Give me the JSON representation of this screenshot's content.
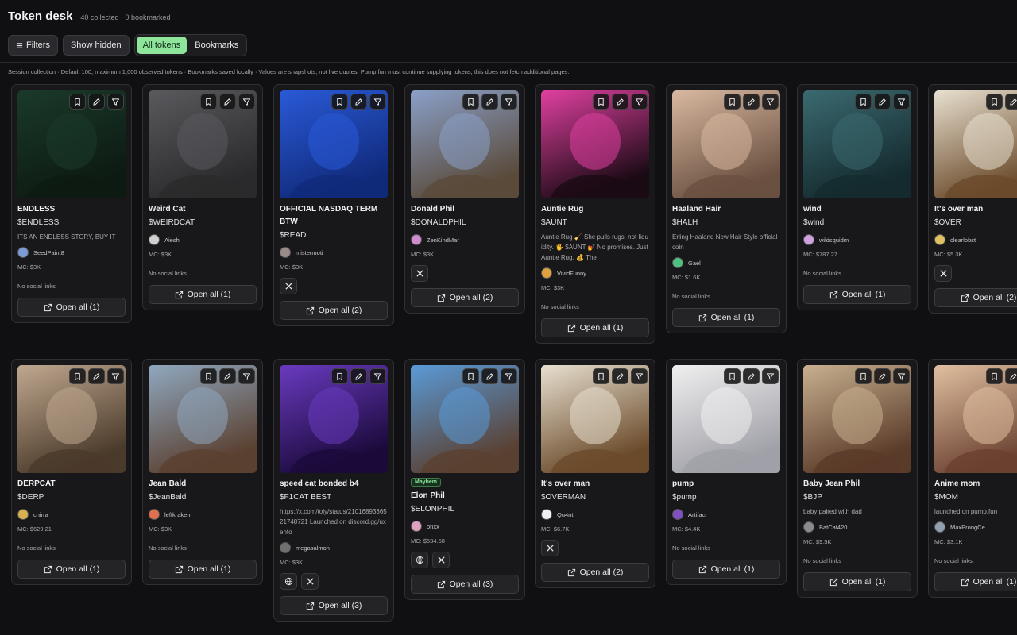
{
  "app": {
    "title": "Token desk",
    "stats": "40 collected · 0 bookmarked"
  },
  "toolbar": {
    "filters_label": "Filters",
    "show_hidden_label": "Show hidden",
    "view_options": [
      {
        "label": "All tokens",
        "active": true
      },
      {
        "label": "Bookmarks",
        "active": false
      }
    ]
  },
  "note": "Session collection · Default 100, maximum 1,000 observed tokens · Bookmarks saved locally · Values are snapshots, not live quotes. Pump.fun must continue supplying tokens; this does not fetch additional pages.",
  "no_social_text": "No social links",
  "icons": {
    "bookmark": "bookmark-icon",
    "edit": "pencil-icon",
    "filter": "filter-icon",
    "open": "external-link-icon",
    "web": "globe-icon",
    "x": "x-logo-icon"
  },
  "tokens": [
    {
      "name": "ENDLESS",
      "ticker": "$ENDLESS",
      "desc": "ITS AN ENDLESS STORY, BUY IT",
      "creator": "SeedPaint8",
      "mc": "MC: $3K",
      "socials": [],
      "open": "Open all (1)",
      "colors": [
        "#1a3a2a",
        "#0d1a12"
      ],
      "avatar": "#7a9ad8"
    },
    {
      "name": "Weird Cat",
      "ticker": "$WEIRDCAT",
      "desc": "",
      "creator": "Aiesh",
      "mc": "MC: $3K",
      "socials": [],
      "open": "Open all (1)",
      "colors": [
        "#5a5a5e",
        "#2a2a2c"
      ],
      "avatar": "#cfcfcf"
    },
    {
      "name": "OFFICIAL NASDAQ TERM BTW",
      "ticker": "$READ",
      "desc": "",
      "creator": "mistermoti",
      "mc": "MC: $3K",
      "socials": [
        "x"
      ],
      "open": "Open all (2)",
      "colors": [
        "#2a5ad8",
        "#102a7a"
      ],
      "avatar": "#9a8a8a"
    },
    {
      "name": "Donald Phil",
      "ticker": "$DONALDPHIL",
      "desc": "",
      "creator": "ZenKindMar",
      "mc": "MC: $3K",
      "socials": [
        "x"
      ],
      "open": "Open all (2)",
      "colors": [
        "#8aa0c8",
        "#5a4a3a"
      ],
      "avatar": "#d08ad0"
    },
    {
      "name": "Auntie Rug",
      "ticker": "$AUNT",
      "desc": "Auntie Rug 🧹 She pulls rugs, not liquidity. 🖐 $AUNT 💅 No promises. Just Auntie Rug. 💰 The",
      "creator": "VividFunny",
      "mc": "MC: $3K",
      "socials": [],
      "open": "Open all (1)",
      "colors": [
        "#e040a0",
        "#1a0a14"
      ],
      "avatar": "#e0a040"
    },
    {
      "name": "Haaland Hair",
      "ticker": "$HALH",
      "desc": "Erling Haaland New Hair Style official coin",
      "creator": "Gael",
      "mc": "MC: $1.6K",
      "socials": [],
      "open": "Open all (1)",
      "colors": [
        "#d8b8a0",
        "#6a5040"
      ],
      "avatar": "#50c080"
    },
    {
      "name": "wind",
      "ticker": "$wind",
      "desc": "",
      "creator": "wildsquidm",
      "mc": "MC: $787.27",
      "socials": [],
      "open": "Open all (1)",
      "colors": [
        "#3a6a70",
        "#142a2e"
      ],
      "avatar": "#d0a0e0"
    },
    {
      "name": "It's over man",
      "ticker": "$OVER",
      "desc": "",
      "creator": "clearlobst",
      "mc": "MC: $5.3K",
      "socials": [
        "x"
      ],
      "open": "Open all (2)",
      "colors": [
        "#e8e0d0",
        "#6a4a2a"
      ],
      "avatar": "#e0c060"
    },
    {
      "name": "DERPCAT",
      "ticker": "$DERP",
      "desc": "",
      "creator": "chirra",
      "mc": "MC: $629.21",
      "socials": [],
      "open": "Open all (1)",
      "colors": [
        "#c0a890",
        "#4a3a2a"
      ],
      "avatar": "#d8b050"
    },
    {
      "name": "Jean Bald",
      "ticker": "$JeanBald",
      "desc": "",
      "creator": "leftkraken",
      "mc": "MC: $3K",
      "socials": [],
      "open": "Open all (1)",
      "colors": [
        "#90a8c0",
        "#5a4030"
      ],
      "avatar": "#e07050"
    },
    {
      "name": "speed cat bonded b4",
      "ticker": "$F1CAT BEST",
      "desc": "https://x.com/toly/status/2101689336521748721 Launched on discord.gg/uxento",
      "creator": "megasalmon",
      "mc": "MC: $3K",
      "socials": [
        "web",
        "x"
      ],
      "open": "Open all (3)",
      "colors": [
        "#6a3ac0",
        "#1a0a3a"
      ],
      "avatar": "#707070"
    },
    {
      "name": "Elon Phil",
      "ticker": "$ELONPHIL",
      "desc": "",
      "creator": "onxx",
      "mc": "MC: $534.58",
      "socials": [
        "web",
        "x"
      ],
      "open": "Open all (3)",
      "colors": [
        "#5a9ad8",
        "#5a4030"
      ],
      "avatar": "#e0a0c0",
      "badge": "Mayhem"
    },
    {
      "name": "It's over man",
      "ticker": "$OVERMAN",
      "desc": "",
      "creator": "Qu4nt",
      "mc": "MC: $6.7K",
      "socials": [
        "x"
      ],
      "open": "Open all (2)",
      "colors": [
        "#e8e0d0",
        "#6a4a2a"
      ],
      "avatar": "#f0f0f0"
    },
    {
      "name": "pump",
      "ticker": "$pump",
      "desc": "",
      "creator": "Artifact",
      "mc": "MC: $4.4K",
      "socials": [],
      "open": "Open all (1)",
      "colors": [
        "#f0f0f0",
        "#a0a0a8"
      ],
      "avatar": "#8050c0"
    },
    {
      "name": "Baby Jean Phil",
      "ticker": "$BJP",
      "desc": "baby paired with dad",
      "creator": "BatCat420",
      "mc": "MC: $9.5K",
      "socials": [],
      "open": "Open all (1)",
      "colors": [
        "#c8b090",
        "#5a3a28"
      ],
      "avatar": "#8a8a90"
    },
    {
      "name": "Anime mom",
      "ticker": "$MOM",
      "desc": "launched on pump.fun",
      "creator": "MaxProngCe",
      "mc": "MC: $3.1K",
      "socials": [],
      "open": "Open all (1)",
      "colors": [
        "#e0c0a0",
        "#6a4030"
      ],
      "avatar": "#90a0b0"
    }
  ]
}
